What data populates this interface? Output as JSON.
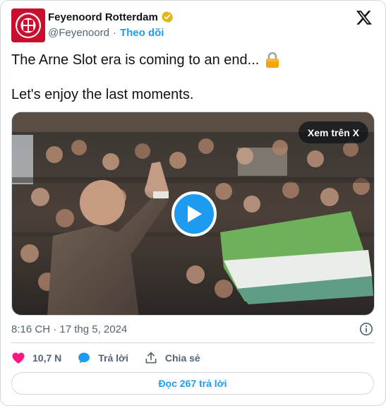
{
  "account": {
    "display_name": "Feyenoord Rotterdam",
    "handle": "@Feyenoord",
    "separator": "·",
    "follow_label": "Theo dõi",
    "avatar_text": "FEYENOORD",
    "avatar_color": "#c8102e",
    "verified_badge_color": "#e2b719"
  },
  "post": {
    "line1": "The Arne Slot era is coming to an end...",
    "line1_emoji": "lock-icon",
    "line2": "Let's enjoy the last moments."
  },
  "media": {
    "view_on_x_label": "Xem trên X",
    "play_color": "#1d9bf0"
  },
  "meta": {
    "timestamp": "8:16 CH · 17 thg 5, 2024"
  },
  "actions": {
    "likes_count": "10,7 N",
    "reply_label": "Trả lời",
    "share_label": "Chia sẻ"
  },
  "footer": {
    "read_replies_label": "Đọc 267 trả lời"
  },
  "colors": {
    "accent": "#1d9bf0",
    "like": "#f91880",
    "secondary_text": "#536471",
    "border": "#cfd9de"
  }
}
